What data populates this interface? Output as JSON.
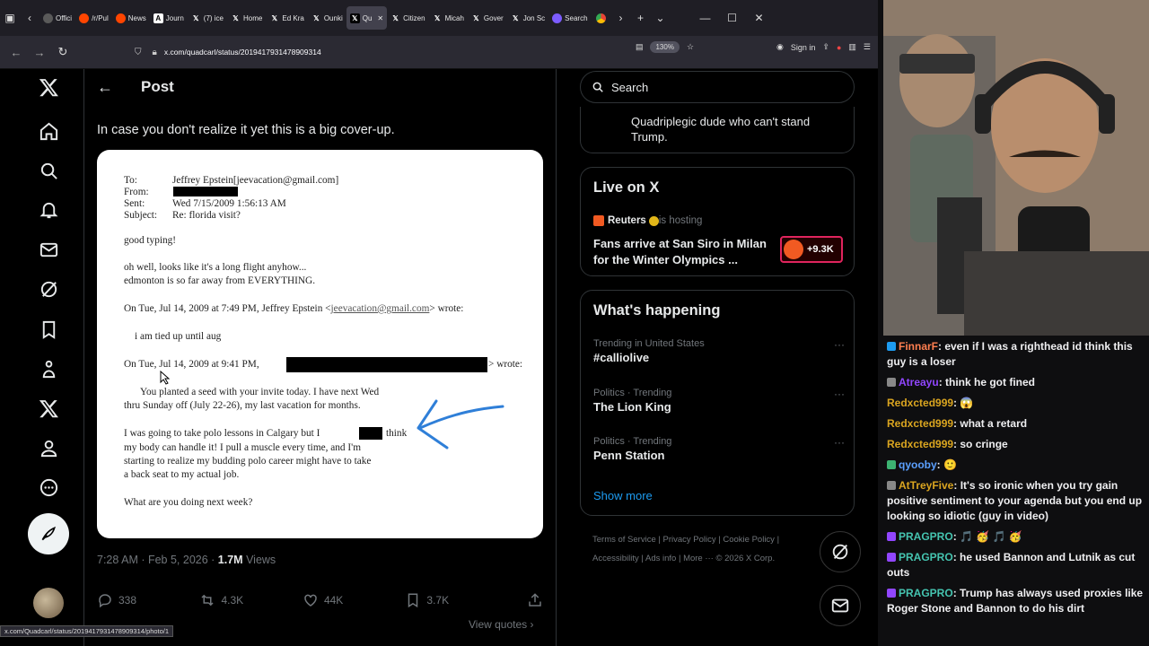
{
  "browser": {
    "tabs": [
      "Offici",
      "/r/Pul",
      "News",
      "Journ",
      "(7) ice",
      "Home",
      "Ed Kra",
      "Ounki",
      "Qu",
      "Citizen",
      "Micah",
      "Gover",
      "Jon Sc",
      "Search"
    ],
    "url": "x.com/quadcarl/status/2019417931478909314",
    "zoom": "130%",
    "signin": "Sign in",
    "status_url": "x.com/Quadcarl/status/2019417931478909314/photo/1"
  },
  "post": {
    "header_title": "Post",
    "text": "In case you don't realize it yet this is a big cover-up.",
    "timestamp": "7:28 AM · Feb 5, 2026 · ",
    "views_count": "1.7M",
    "views_label": " Views",
    "replies": "338",
    "reposts": "4.3K",
    "likes": "44K",
    "bookmarks": "3.7K",
    "view_quotes": "View quotes ›"
  },
  "email": {
    "to_label": "To:",
    "to_value": "Jeffrey Epstein[jeevacation@gmail.com]",
    "from_label": "From:",
    "sent_label": "Sent:",
    "sent_value": "Wed 7/15/2009 1:56:13 AM",
    "subject_label": "Subject:",
    "subject_value": "Re: florida visit?",
    "l1": "good typing!",
    "l2": "oh well, looks like it's a long flight anyhow...",
    "l3": "edmonton is so far away from EVERYTHING.",
    "l4a": "On Tue, Jul 14, 2009 at 7:49 PM, Jeffrey Epstein <",
    "l4b": "jeevacation@gmail.com",
    "l4c": "> wrote:",
    "l5": "i am tied up until aug",
    "l6a": "On Tue, Jul 14, 2009 at 9:41 PM,",
    "l6b": "> wrote:",
    "l7": "You planted a seed with your invite today. I have next Wed",
    "l8": "thru Sunday off (July 22-26), my last vacation for months.",
    "l9a": "I was going to take polo lessons in Calgary but I",
    "l9b": "think",
    "l10": "my body can handle it! I pull a muscle every time, and I'm",
    "l11": "starting to realize my budding polo career might have to take",
    "l12": "a back seat to my actual job.",
    "l13": "What are you doing next week?"
  },
  "sidebar": {
    "search_placeholder": "Search",
    "bio_line1": "Quadriplegic dude who can't stand",
    "bio_line2": "Trump.",
    "live_title": "Live on X",
    "live_host": "Reuters",
    "live_hosting": " is hosting",
    "live_headline1": "Fans arrive at San Siro in Milan",
    "live_headline2": "for the Winter Olympics ...",
    "live_count": "+9.3K",
    "happening_title": "What's happening",
    "trends": [
      {
        "category": "Trending in United States",
        "name": "#calliolive"
      },
      {
        "category": "Politics · Trending",
        "name": "The Lion King"
      },
      {
        "category": "Politics · Trending",
        "name": "Penn Station"
      }
    ],
    "show_more": "Show more",
    "footer": [
      "Terms of Service",
      "Privacy Policy",
      "Cookie Policy",
      "Accessibility",
      "Ads info",
      "More ···",
      "© 2026 X Corp."
    ]
  },
  "chat": [
    {
      "user": "FinnarF",
      "color": "#ff7f50",
      "text": ": even if I was a righthead id think this guy is a loser"
    },
    {
      "user": "Atreayu",
      "color": "#9146ff",
      "text": ": think he got fined"
    },
    {
      "user": "Redxcted999",
      "color": "#daa520",
      "text": ": 😱"
    },
    {
      "user": "Redxcted999",
      "color": "#daa520",
      "text": ": what a retard"
    },
    {
      "user": "Redxcted999",
      "color": "#daa520",
      "text": ": so cringe"
    },
    {
      "user": "qyooby",
      "color": "#5ba0ff",
      "text": ": 🙂"
    },
    {
      "user": "AtTreyFive",
      "color": "#daa520",
      "text": ": It's so ironic when you try gain positive sentiment to your agenda but you end up looking so idiotic (guy in video)"
    },
    {
      "user": "PRAGPRO",
      "color": "#45c4b0",
      "text": ": 🎵 🥳 🎵 🥳"
    },
    {
      "user": "PRAGPRO",
      "color": "#45c4b0",
      "text": ": he used Bannon and Lutnik as cut outs"
    },
    {
      "user": "PRAGPRO",
      "color": "#45c4b0",
      "text": ": Trump has always used proxies like Roger Stone and Bannon to do his dirt"
    }
  ]
}
